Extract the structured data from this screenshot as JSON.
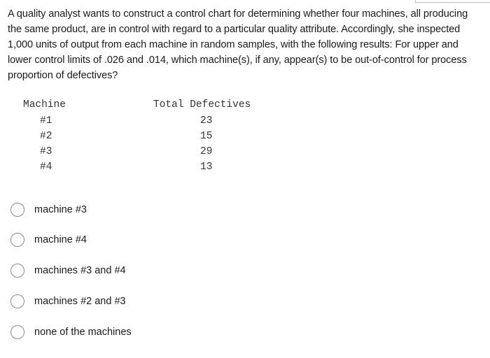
{
  "question": {
    "text": "A quality analyst wants to construct a control chart for determining whether four machines, all producing the same product, are in control with regard to a particular quality attribute. Accordingly, she inspected 1,000 units of output from each machine in random samples, with the following results: For upper and lower control limits of .026 and .014, which machine(s), if any, appear(s) to be out-of-control for process proportion of defectives?"
  },
  "table": {
    "headers": [
      "Machine",
      "Total Defectives"
    ],
    "rows": [
      {
        "machine": "#1",
        "defectives": "23"
      },
      {
        "machine": "#2",
        "defectives": "15"
      },
      {
        "machine": "#3",
        "defectives": "29"
      },
      {
        "machine": "#4",
        "defectives": "13"
      }
    ]
  },
  "options": [
    {
      "label": "machine #3",
      "selected": false
    },
    {
      "label": "machine #4",
      "selected": false
    },
    {
      "label": "machines #3 and #4",
      "selected": false
    },
    {
      "label": "machines #2 and #3",
      "selected": false
    },
    {
      "label": "none of the machines",
      "selected": false
    }
  ]
}
